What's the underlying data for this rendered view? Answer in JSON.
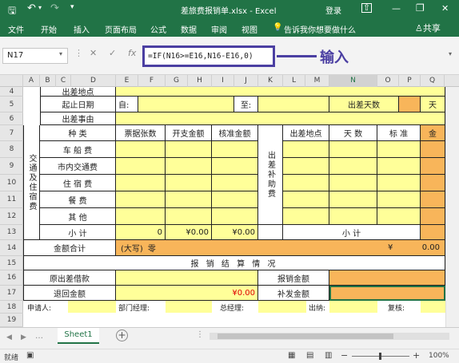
{
  "titlebar": {
    "save_icon": "save-icon",
    "undo_icon": "undo-icon",
    "filename": "差旅费报销单.xlsx",
    "app": "Excel",
    "login": "登录",
    "minimize": "—",
    "restore": "❐",
    "close": "✕"
  },
  "ribbon": {
    "tabs": [
      "文件",
      "开始",
      "插入",
      "页面布局",
      "公式",
      "数据",
      "审阅",
      "视图"
    ],
    "tell_me": "告诉我你想要做什么",
    "share": "共享"
  },
  "formula_bar": {
    "name_box": "N17",
    "fx": "fx",
    "formula": "=IF(N16>=E16,N16-E16,0)",
    "annotation": "输入"
  },
  "columns": [
    "A",
    "B",
    "C",
    "D",
    "E",
    "F",
    "G",
    "H",
    "I",
    "J",
    "K",
    "L",
    "M",
    "N",
    "O",
    "P",
    "Q"
  ],
  "rows": [
    "4",
    "5",
    "6",
    "7",
    "8",
    "9",
    "10",
    "11",
    "12",
    "13",
    "14",
    "15",
    "16",
    "17",
    "18",
    "19"
  ],
  "form": {
    "trip_place": "出差地点",
    "start_end_date": "起止日期",
    "from": "自:",
    "to": "至:",
    "trip_days": "出差天数",
    "day_unit": "天",
    "trip_reason": "出差事由",
    "transport_group": "交通及住宿费",
    "category": "种 类",
    "receipts": "票据张数",
    "expense_amount": "开支金额",
    "approved_amount": "核准金额",
    "allowance_group": "出差补助费",
    "allow_place": "出差地点",
    "allow_days": "天 数",
    "allow_standard": "标 准",
    "allow_amount": "金",
    "items": [
      "车 船 费",
      "市内交通费",
      "住 宿 费",
      "餐 费",
      "其 他"
    ],
    "subtotal": "小 计",
    "subtotal_count": "0",
    "subtotal_expense": "¥0.00",
    "subtotal_approved": "¥0.00",
    "allow_subtotal": "小 计",
    "total_label": "金额合计",
    "uppercase": "(大写)",
    "uppercase_value": "零",
    "yen": "¥",
    "total_value": "0.00",
    "settlement": "报 销 结 算 情 况",
    "orig_advance": "原出差借款",
    "refund_amount": "退回金额",
    "refund_value": "¥0.00",
    "reimburse_amount": "报销金额",
    "supplement_amount": "补发金额",
    "signatures": [
      "申请人:",
      "部门经理:",
      "总经理:",
      "出纳:",
      "复核:"
    ]
  },
  "sheet_tabs": {
    "active": "Sheet1",
    "add": "+"
  },
  "statusbar": {
    "status": "就绪",
    "zoom": "100%"
  }
}
